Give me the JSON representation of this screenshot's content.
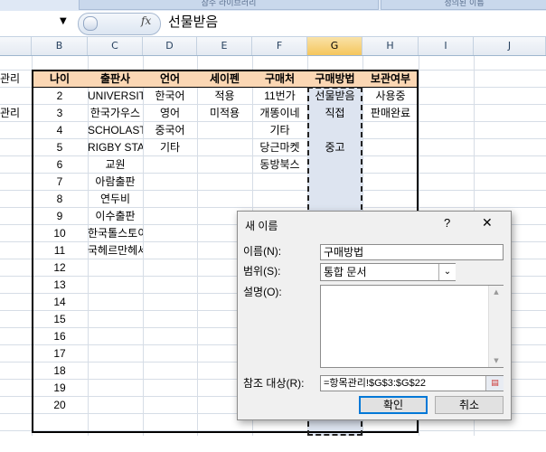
{
  "ribbon": {
    "tab_left": "참수 라이브러리",
    "tab_right": "정의된 이름"
  },
  "formula_bar": {
    "fx_label": "fx",
    "value": "선물받음"
  },
  "columns": [
    "B",
    "C",
    "D",
    "E",
    "F",
    "G",
    "H",
    "I",
    "J"
  ],
  "selected_column": "G",
  "left_clip": {
    "row1": "관리",
    "row3": "관리"
  },
  "table": {
    "headers": [
      "나이",
      "출판사",
      "언어",
      "세이펜",
      "구매처",
      "구매방법",
      "보관여부"
    ],
    "rows": [
      {
        "n": "2",
        "publisher": "UNIVERSIT",
        "lang": "한국어",
        "saypen": "적용",
        "where": "11번가",
        "how": "선물받음",
        "keep": "사용중"
      },
      {
        "n": "3",
        "publisher": "한국가우스",
        "lang": "영어",
        "saypen": "미적용",
        "where": "개똥이네",
        "how": "직접",
        "keep": "판매완료"
      },
      {
        "n": "4",
        "publisher": "SCHOLASTIC",
        "lang": "중국어",
        "saypen": "",
        "where": "기타",
        "how": "",
        "keep": ""
      },
      {
        "n": "5",
        "publisher": "RIGBY STAR",
        "lang": "기타",
        "saypen": "",
        "where": "당근마켓",
        "how": "중고",
        "keep": ""
      },
      {
        "n": "6",
        "publisher": "교원",
        "lang": "",
        "saypen": "",
        "where": "동방북스",
        "how": "",
        "keep": ""
      },
      {
        "n": "7",
        "publisher": "아람출판",
        "lang": "",
        "saypen": "",
        "where": "",
        "how": "",
        "keep": ""
      },
      {
        "n": "8",
        "publisher": "연두비",
        "lang": "",
        "saypen": "",
        "where": "",
        "how": "",
        "keep": ""
      },
      {
        "n": "9",
        "publisher": "이수출판",
        "lang": "",
        "saypen": "",
        "where": "",
        "how": "",
        "keep": ""
      },
      {
        "n": "10",
        "publisher": "한국톨스토이",
        "lang": "",
        "saypen": "",
        "where": "",
        "how": "",
        "keep": ""
      },
      {
        "n": "11",
        "publisher": "국헤르만헤세",
        "lang": "",
        "saypen": "",
        "where": "",
        "how": "",
        "keep": ""
      },
      {
        "n": "12",
        "publisher": "",
        "lang": "",
        "saypen": "",
        "where": "",
        "how": "",
        "keep": ""
      },
      {
        "n": "13",
        "publisher": "",
        "lang": "",
        "saypen": "",
        "where": "",
        "how": "",
        "keep": ""
      },
      {
        "n": "14",
        "publisher": "",
        "lang": "",
        "saypen": "",
        "where": "",
        "how": "",
        "keep": ""
      },
      {
        "n": "15",
        "publisher": "",
        "lang": "",
        "saypen": "",
        "where": "",
        "how": "",
        "keep": ""
      },
      {
        "n": "16",
        "publisher": "",
        "lang": "",
        "saypen": "",
        "where": "",
        "how": "",
        "keep": ""
      },
      {
        "n": "17",
        "publisher": "",
        "lang": "",
        "saypen": "",
        "where": "",
        "how": "",
        "keep": ""
      },
      {
        "n": "18",
        "publisher": "",
        "lang": "",
        "saypen": "",
        "where": "",
        "how": "",
        "keep": ""
      },
      {
        "n": "19",
        "publisher": "",
        "lang": "",
        "saypen": "",
        "where": "",
        "how": "",
        "keep": ""
      },
      {
        "n": "20",
        "publisher": "",
        "lang": "",
        "saypen": "",
        "where": "",
        "how": "",
        "keep": ""
      }
    ]
  },
  "dialog": {
    "title": "새 이름",
    "help": "?",
    "close": "✕",
    "name_label": "이름(N):",
    "name_value": "구매방법",
    "scope_label": "범위(S):",
    "scope_value": "통합 문서",
    "comment_label": "설명(O):",
    "ref_label": "참조 대상(R):",
    "ref_value": "=항목관리!$G$3:$G$22",
    "ok": "확인",
    "cancel": "취소"
  }
}
